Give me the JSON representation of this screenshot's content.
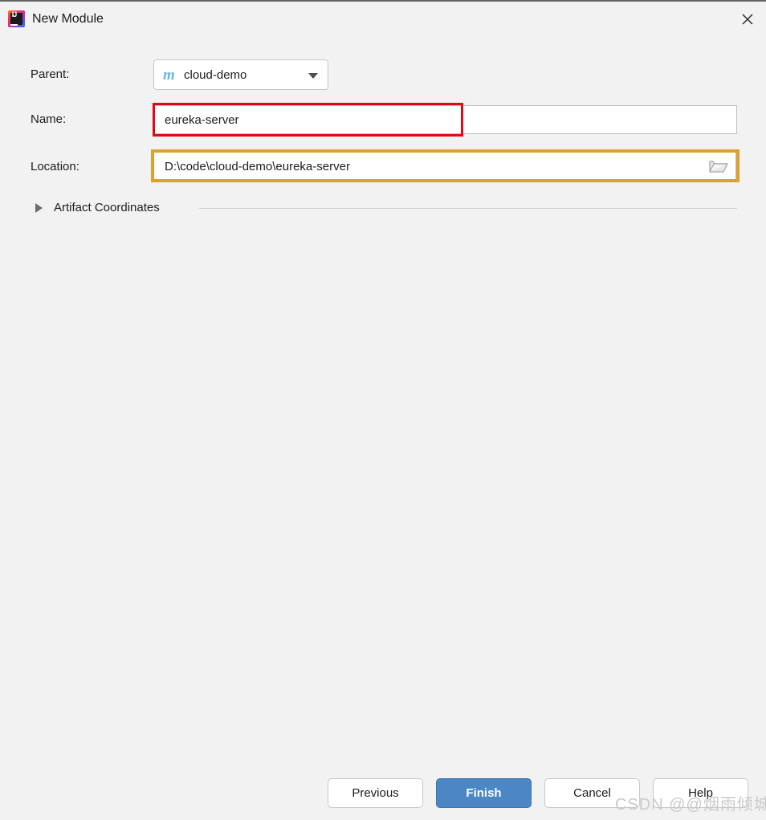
{
  "window": {
    "title": "New Module",
    "app_icon": "intellij-idea-icon",
    "close_icon": "close-icon"
  },
  "form": {
    "parent": {
      "label": "Parent:",
      "value": "cloud-demo",
      "icon": "maven-module-icon",
      "icon_glyph": "m",
      "dropdown_icon": "chevron-down-icon"
    },
    "name": {
      "label": "Name:",
      "value": "eureka-server",
      "annotation_color": "#e30613"
    },
    "location": {
      "label": "Location:",
      "value": "D:\\code\\cloud-demo\\eureka-server",
      "browse_icon": "folder-open-icon",
      "annotation_color": "#dfa12d"
    }
  },
  "artifact_section": {
    "label": "Artifact Coordinates",
    "expanded": false,
    "toggle_icon": "triangle-right-icon"
  },
  "buttons": {
    "previous": "Previous",
    "finish": "Finish",
    "cancel": "Cancel",
    "help": "Help",
    "primary_color": "#4a87c4"
  },
  "watermark": {
    "text": "CSDN @@烟雨倾城"
  }
}
